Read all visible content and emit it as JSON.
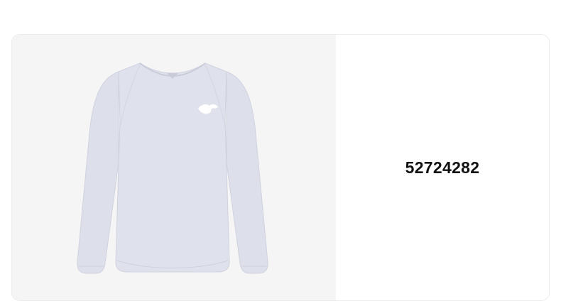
{
  "product": {
    "id": "52724282",
    "image_icon": "long-sleeve-shirt-icon",
    "brand_mark_icon": "puma-logo-icon",
    "shirt_color": "#dfe1ec"
  }
}
